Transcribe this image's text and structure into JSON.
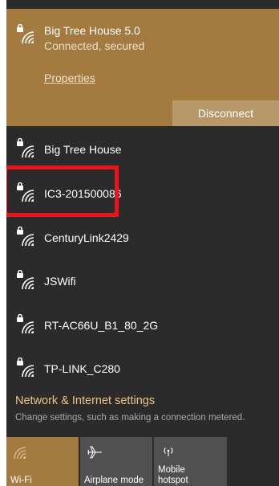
{
  "colors": {
    "accent": "#a37a3f",
    "panel_bg": "#2b2b2b",
    "disconnect_bg": "#b79869",
    "tile_bg": "#505050",
    "highlight": "#e8161c"
  },
  "connected_network": {
    "name": "Big Tree House 5.0",
    "status": "Connected, secured",
    "properties_label": "Properties",
    "disconnect_label": "Disconnect",
    "icon": "secured-wifi-icon"
  },
  "networks": [
    {
      "name": "Big Tree House",
      "icon": "secured-wifi-icon"
    },
    {
      "name": "IC3-201500086",
      "icon": "secured-wifi-icon"
    },
    {
      "name": "CenturyLink2429",
      "icon": "secured-wifi-icon"
    },
    {
      "name": "JSWifi",
      "icon": "secured-wifi-icon"
    },
    {
      "name": "RT-AC66U_B1_80_2G",
      "icon": "secured-wifi-icon"
    },
    {
      "name": "TP-LINK_C280",
      "icon": "secured-wifi-icon"
    }
  ],
  "settings": {
    "title": "Network & Internet settings",
    "subtitle": "Change settings, such as making a connection metered."
  },
  "tiles": {
    "wifi": {
      "label": "Wi-Fi",
      "icon": "wifi-icon",
      "active": true
    },
    "airplane": {
      "label": "Airplane mode",
      "icon": "airplane-icon",
      "active": false
    },
    "hotspot": {
      "label_line1": "Mobile",
      "label_line2": "hotspot",
      "icon": "hotspot-icon",
      "active": false
    }
  }
}
